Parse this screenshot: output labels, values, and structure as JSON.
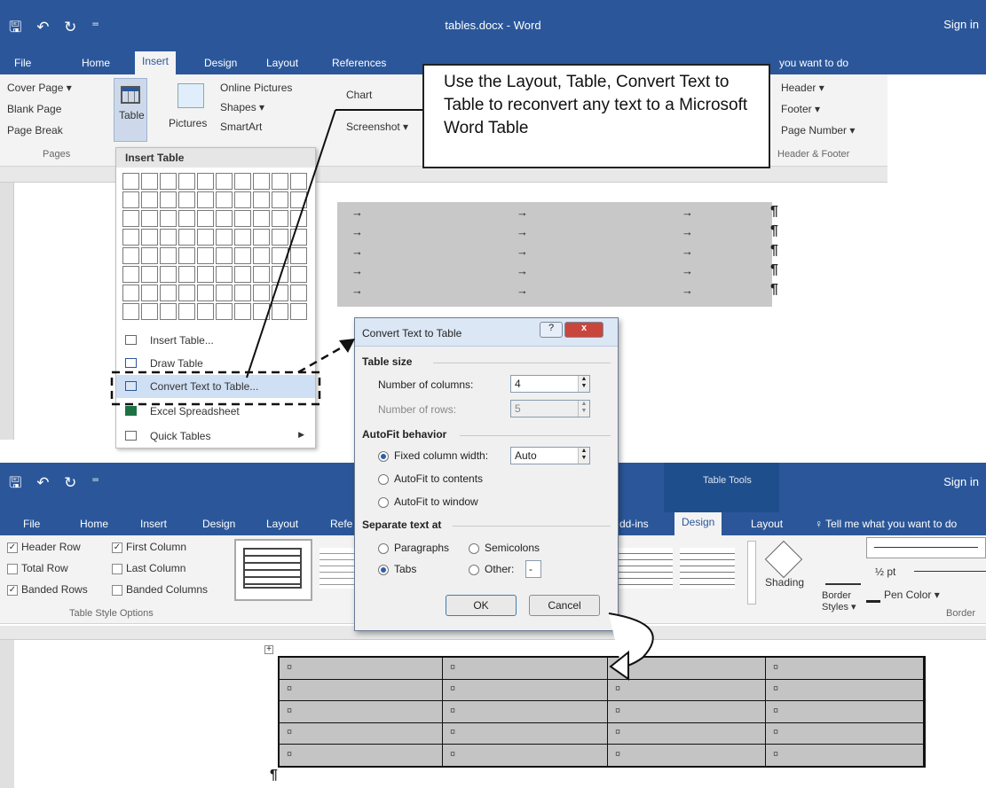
{
  "top_window": {
    "qat": "🖫 ↶ ↻ ⁼",
    "title": "tables.docx - Word",
    "signin": "Sign in",
    "tabs": [
      "File",
      "Home",
      "Insert",
      "Design",
      "Layout",
      "References"
    ],
    "tell_me": "you want to do",
    "ribbon": {
      "cover_page": "Cover Page ▾",
      "blank_page": "Blank Page",
      "page_break": "Page Break",
      "pages_group": "Pages",
      "table": "Table",
      "pictures": "Pictures",
      "online_pictures": "Online Pictures",
      "shapes": "Shapes ▾",
      "smartart": "SmartArt",
      "chart": "Chart",
      "screenshot": "Screenshot ▾",
      "header": "Header ▾",
      "footer": "Footer ▾",
      "page_number": "Page Number ▾",
      "header_footer_group": "Header & Footer"
    }
  },
  "callout": {
    "text": "Use the Layout, Table, Convert Text to Table to reconvert any text to a Microsoft Word Table"
  },
  "table_dropdown": {
    "heading": "Insert Table",
    "items": [
      "Insert Table...",
      "Draw Table",
      "Convert Text to Table...",
      "Excel Spreadsheet",
      "Quick Tables"
    ]
  },
  "dialog": {
    "title": "Convert Text to Table",
    "help": "?",
    "close": "x",
    "table_size": "Table size",
    "num_columns_label": "Number of columns:",
    "num_columns_value": "4",
    "num_rows_label": "Number of rows:",
    "num_rows_value": "5",
    "autofit": "AutoFit behavior",
    "fixed_width": "Fixed column width:",
    "fixed_width_value": "Auto",
    "autofit_contents": "AutoFit to contents",
    "autofit_window": "AutoFit to window",
    "separate": "Separate text at",
    "paragraphs": "Paragraphs",
    "semicolons": "Semicolons",
    "tabs": "Tabs",
    "other": "Other:",
    "other_value": "-",
    "ok": "OK",
    "cancel": "Cancel"
  },
  "bottom_window": {
    "qat": "🖫 ↶ ↻ ⁼",
    "table_tools": "Table Tools",
    "signin": "Sign in",
    "tabs": [
      "File",
      "Home",
      "Insert",
      "Design",
      "Layout",
      "Refe",
      "dd-ins",
      "Design",
      "Layout"
    ],
    "tell_me": "Tell me what you want to do",
    "options": {
      "header_row": "Header Row",
      "first_column": "First Column",
      "total_row": "Total Row",
      "last_column": "Last Column",
      "banded_rows": "Banded Rows",
      "banded_columns": "Banded Columns",
      "group": "Table Style Options"
    },
    "shading": "Shading",
    "border_styles": "Border Styles ▾",
    "pen_weight": "½ pt",
    "pen_color": "Pen Color ▾",
    "borders_group": "Border"
  },
  "tab_arrow": "→",
  "pilcrow": "¶",
  "cell_mark": "¤"
}
